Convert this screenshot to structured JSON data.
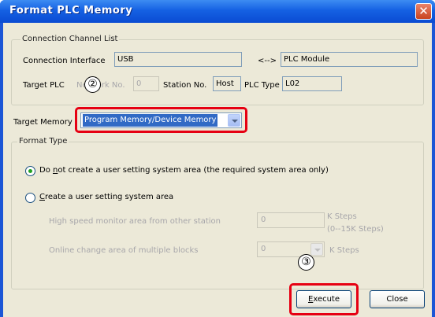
{
  "window": {
    "title": "Format PLC Memory",
    "close_glyph": "✕"
  },
  "connection": {
    "group_label": "Connection Channel List",
    "interface_label": "Connection Interface",
    "interface_value": "USB",
    "arrow_label": "<-->",
    "module_value": "PLC Module",
    "target_plc_label": "Target PLC",
    "network_no_label": "Network No.",
    "network_no_value": "0",
    "station_no_label": "Station No.",
    "station_no_value": "Host",
    "plc_type_label": "PLC Type",
    "plc_type_value": "L02"
  },
  "target_memory": {
    "label": "Target Memory",
    "value": "Program Memory/Device Memory"
  },
  "format_type": {
    "group_label": "Format Type",
    "option1_pre": "Do ",
    "option1_acc": "n",
    "option1_post": "ot create a user setting system area (the required system area only)",
    "option2_acc": "C",
    "option2_post": "reate a user setting system area",
    "option1_checked": true,
    "high_speed_label": "High speed monitor area from other station",
    "high_speed_value": "0",
    "high_speed_unit": "K Steps",
    "high_speed_range": "(0--15K Steps)",
    "online_change_label": "Online change area of multiple blocks",
    "online_change_value": "0",
    "online_change_unit": "K Steps"
  },
  "buttons": {
    "execute_acc": "E",
    "execute_post": "xecute",
    "close": "Close"
  },
  "annotations": {
    "marker_2": "②",
    "marker_3": "③",
    "highlight_color": "#e60012"
  },
  "colors": {
    "titlebar": "#0a4bd2",
    "dialog_bg": "#ece9d8",
    "selection": "#316ac5"
  }
}
